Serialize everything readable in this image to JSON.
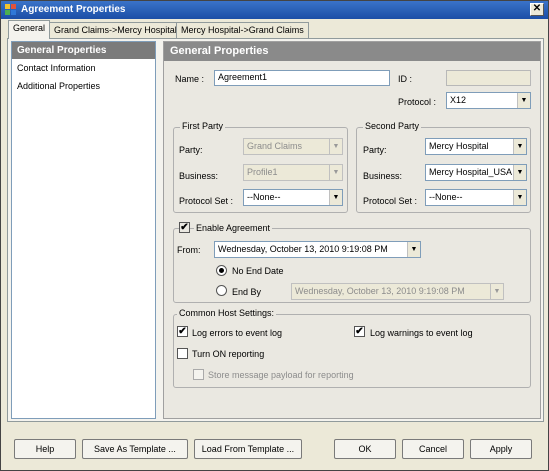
{
  "window": {
    "title": "Agreement Properties",
    "close_glyph": "✕"
  },
  "tabs": [
    "General",
    "Grand Claims->Mercy Hospital",
    "Mercy Hospital->Grand Claims"
  ],
  "nav": {
    "header": "General Properties",
    "items": [
      "Contact Information",
      "Additional Properties"
    ]
  },
  "pane": {
    "header": "General Properties",
    "name_label": "Name :",
    "name_value": "Agreement1",
    "id_label": "ID :",
    "id_value": "",
    "protocol_label": "Protocol :",
    "protocol_value": "X12"
  },
  "first_party": {
    "legend": "First Party",
    "party_label": "Party:",
    "party_value": "Grand Claims",
    "business_label": "Business:",
    "business_value": "Profile1",
    "protocol_set_label": "Protocol Set :",
    "protocol_set_value": "--None--"
  },
  "second_party": {
    "legend": "Second Party",
    "party_label": "Party:",
    "party_value": "Mercy Hospital",
    "business_label": "Business:",
    "business_value": "Mercy Hospital_USA",
    "protocol_set_label": "Protocol Set :",
    "protocol_set_value": "--None--"
  },
  "enable": {
    "label": "Enable Agreement",
    "checked": true,
    "from_label": "From:",
    "from_date": "Wednesday,   October   13, 2010   9:19:08 PM",
    "no_end_label": "No End Date",
    "end_by_label": "End By",
    "end_by_date": "Wednesday,   October   13, 2010   9:19:08 PM"
  },
  "host": {
    "legend": "Common Host Settings:",
    "log_errors": "Log errors to event log",
    "log_warnings": "Log warnings to event log",
    "turn_on": "Turn ON reporting",
    "store_payload": "Store message payload for reporting"
  },
  "buttons": {
    "help": "Help",
    "save_template": "Save As Template ...",
    "load_template": "Load From Template ...",
    "ok": "OK",
    "cancel": "Cancel",
    "apply": "Apply"
  },
  "glyphs": {
    "check": "✔",
    "dropdown": "▼"
  },
  "colors": {
    "title_bar": "#1b4ea6",
    "pane_header": "#8a8a8a",
    "nav_header": "#7b7b7b"
  }
}
